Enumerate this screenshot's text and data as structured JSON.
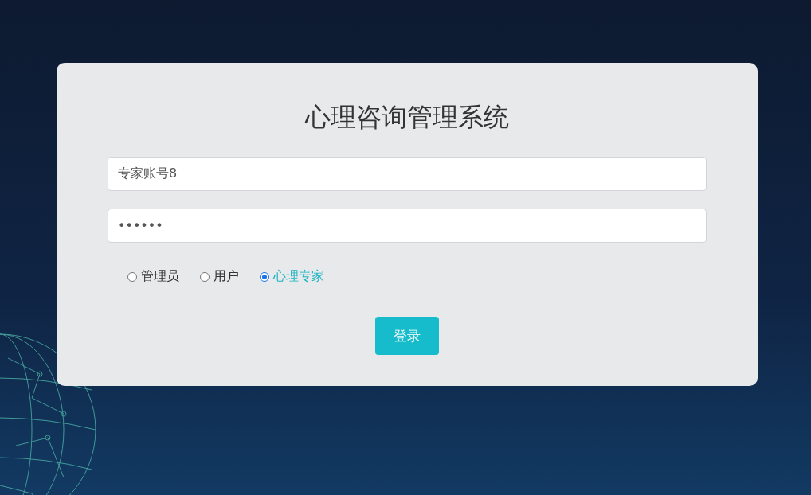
{
  "title": "心理咨询管理系统",
  "username": {
    "value": "专家账号8"
  },
  "password": {
    "value": "••••••"
  },
  "roles": [
    {
      "label": "管理员",
      "selected": false
    },
    {
      "label": "用户",
      "selected": false
    },
    {
      "label": "心理专家",
      "selected": true
    }
  ],
  "login_button": "登录"
}
